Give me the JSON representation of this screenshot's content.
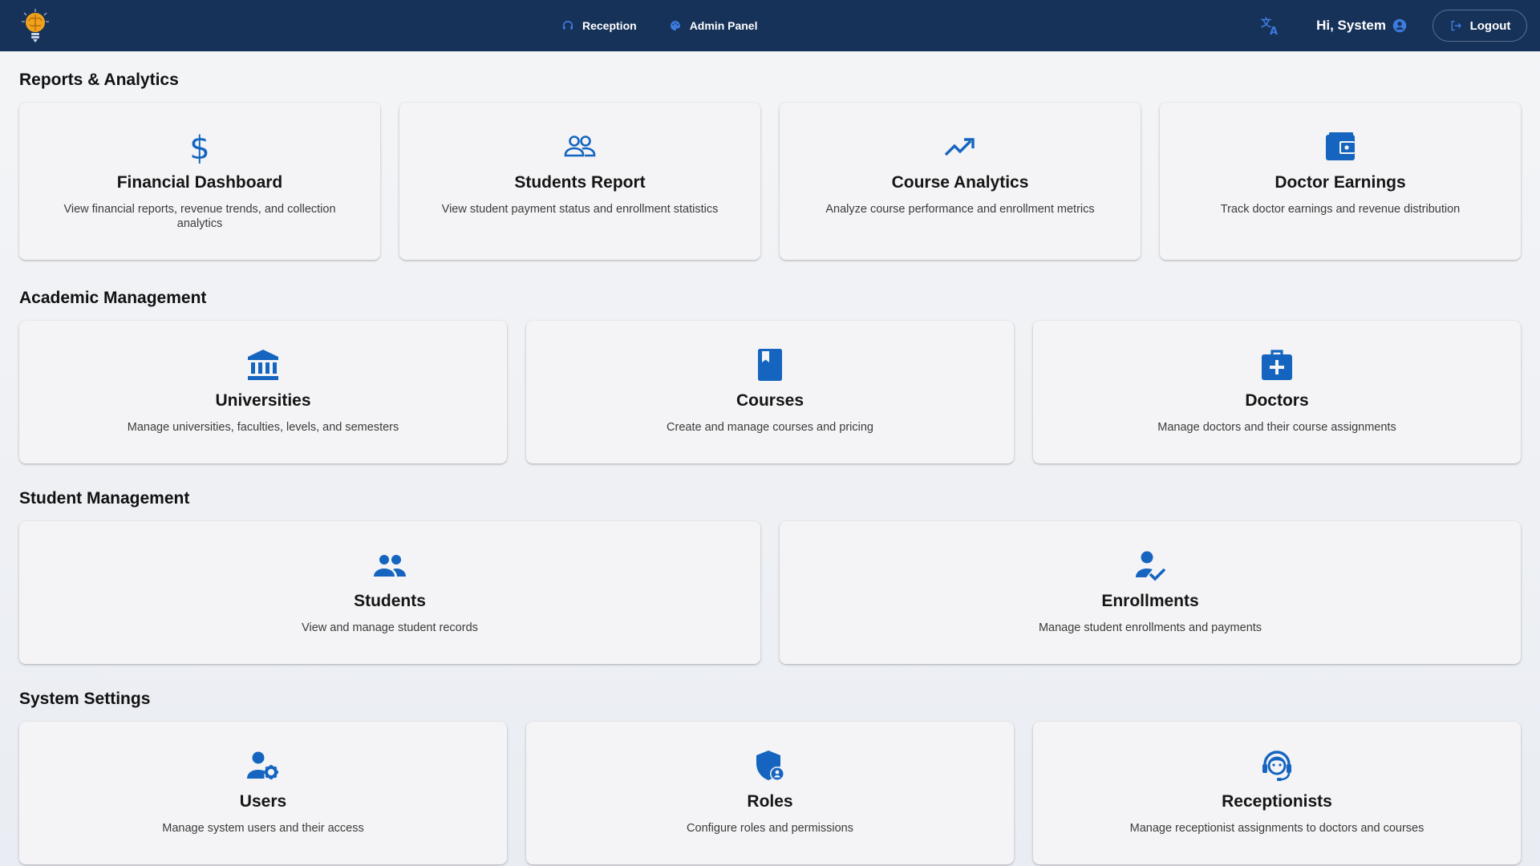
{
  "nav": {
    "reception": "Reception",
    "admin_panel": "Admin Panel",
    "greeting": "Hi, System",
    "logout": "Logout"
  },
  "colors": {
    "topbar": "#173259",
    "accent": "#1565c0",
    "card_bg": "#f4f4f6"
  },
  "sections": {
    "reports": {
      "title": "Reports & Analytics",
      "cards": [
        {
          "icon": "dollar-icon",
          "title": "Financial Dashboard",
          "desc": "View financial reports, revenue trends, and collection analytics"
        },
        {
          "icon": "people-outline-icon",
          "title": "Students Report",
          "desc": "View student payment status and enrollment statistics"
        },
        {
          "icon": "trending-up-icon",
          "title": "Course Analytics",
          "desc": "Analyze course performance and enrollment metrics"
        },
        {
          "icon": "wallet-icon",
          "title": "Doctor Earnings",
          "desc": "Track doctor earnings and revenue distribution"
        }
      ]
    },
    "academic": {
      "title": "Academic Management",
      "cards": [
        {
          "icon": "institution-icon",
          "title": "Universities",
          "desc": "Manage universities, faculties, levels, and semesters"
        },
        {
          "icon": "book-icon",
          "title": "Courses",
          "desc": "Create and manage courses and pricing"
        },
        {
          "icon": "medical-bag-icon",
          "title": "Doctors",
          "desc": "Manage doctors and their course assignments"
        }
      ]
    },
    "student": {
      "title": "Student Management",
      "cards": [
        {
          "icon": "group-icon",
          "title": "Students",
          "desc": "View and manage student records"
        },
        {
          "icon": "person-check-icon",
          "title": "Enrollments",
          "desc": "Manage student enrollments and payments"
        }
      ]
    },
    "system": {
      "title": "System Settings",
      "cards": [
        {
          "icon": "user-gear-icon",
          "title": "Users",
          "desc": "Manage system users and their access"
        },
        {
          "icon": "shield-user-icon",
          "title": "Roles",
          "desc": "Configure roles and permissions"
        },
        {
          "icon": "headset-icon",
          "title": "Receptionists",
          "desc": "Manage receptionist assignments to doctors and courses"
        }
      ]
    }
  }
}
